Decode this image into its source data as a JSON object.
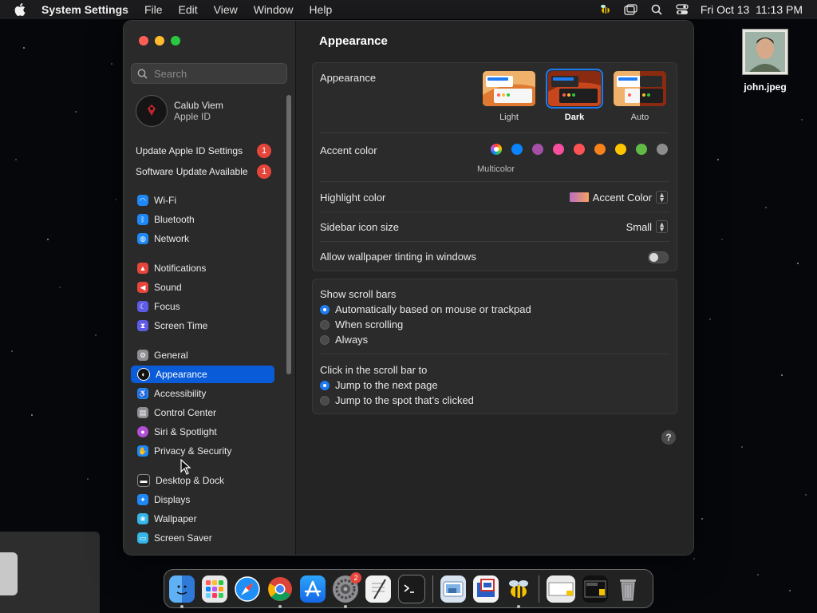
{
  "menubar": {
    "app_name": "System Settings",
    "menus": [
      "File",
      "Edit",
      "View",
      "Window",
      "Help"
    ],
    "clock": "Fri Oct 13  11:13 PM",
    "status_icons": [
      "bee-icon",
      "window-icon",
      "search-icon",
      "control-center-icon"
    ]
  },
  "desktop": {
    "file_name": "john.jpeg"
  },
  "sidebar": {
    "search_placeholder": "Search",
    "account": {
      "name": "Calub Viem",
      "sub": "Apple ID"
    },
    "notices": [
      {
        "label": "Update Apple ID Settings",
        "badge": "1"
      },
      {
        "label": "Software Update Available",
        "badge": "1"
      }
    ],
    "items": [
      {
        "label": "Wi-Fi",
        "icon": "wifi-icon",
        "color": "#1e88f7"
      },
      {
        "label": "Bluetooth",
        "icon": "bluetooth-icon",
        "color": "#1e88f7"
      },
      {
        "label": "Network",
        "icon": "globe-icon",
        "color": "#1e88f7"
      },
      {
        "label": "Notifications",
        "icon": "bell-icon",
        "color": "#e5453b"
      },
      {
        "label": "Sound",
        "icon": "speaker-icon",
        "color": "#e5453b"
      },
      {
        "label": "Focus",
        "icon": "moon-icon",
        "color": "#5e5ce6"
      },
      {
        "label": "Screen Time",
        "icon": "hourglass-icon",
        "color": "#5e5ce6"
      },
      {
        "label": "General",
        "icon": "gear-icon",
        "color": "#8e8e93"
      },
      {
        "label": "Appearance",
        "icon": "appearance-icon",
        "color": "#111111"
      },
      {
        "label": "Accessibility",
        "icon": "accessibility-icon",
        "color": "#1e88f7"
      },
      {
        "label": "Control Center",
        "icon": "control-center-icon",
        "color": "#8e8e93"
      },
      {
        "label": "Siri & Spotlight",
        "icon": "siri-icon",
        "color": "#b34fd6"
      },
      {
        "label": "Privacy & Security",
        "icon": "hand-icon",
        "color": "#1e88f7"
      },
      {
        "label": "Desktop & Dock",
        "icon": "dock-icon",
        "color": "#222222"
      },
      {
        "label": "Displays",
        "icon": "display-icon",
        "color": "#1e88f7"
      },
      {
        "label": "Wallpaper",
        "icon": "wallpaper-icon",
        "color": "#35b6e8"
      },
      {
        "label": "Screen Saver",
        "icon": "screensaver-icon",
        "color": "#35b6e8"
      }
    ],
    "selected": "Appearance"
  },
  "content": {
    "title": "Appearance",
    "appearance": {
      "label": "Appearance",
      "options": [
        "Light",
        "Dark",
        "Auto"
      ],
      "selected": "Dark"
    },
    "accent": {
      "label": "Accent color",
      "colors": [
        "multicolor",
        "#0a84ff",
        "#a550a7",
        "#f74f9e",
        "#ff5257",
        "#f7821b",
        "#ffc600",
        "#62ba46",
        "#8c8c8c"
      ],
      "selected_caption": "Multicolor"
    },
    "highlight": {
      "label": "Highlight color",
      "value": "Accent Color"
    },
    "sidebar_icon_size": {
      "label": "Sidebar icon size",
      "value": "Small"
    },
    "wallpaper_tinting": {
      "label": "Allow wallpaper tinting in windows",
      "on": false
    },
    "scroll_bars": {
      "label": "Show scroll bars",
      "options": [
        "Automatically based on mouse or trackpad",
        "When scrolling",
        "Always"
      ],
      "selected": 0
    },
    "click_scroll": {
      "label": "Click in the scroll bar to",
      "options": [
        "Jump to the next page",
        "Jump to the spot that’s clicked"
      ],
      "selected": 0
    },
    "help": "?"
  },
  "dock": {
    "apps": [
      "finder-icon",
      "launchpad-icon",
      "safari-icon",
      "chrome-icon",
      "app-store-icon",
      "system-settings-icon",
      "textedit-icon",
      "terminal-icon",
      "preview-icon",
      "remote-desktop-icon",
      "bee-app-icon",
      "screenshot-icon",
      "screenshot-2-icon",
      "trash-icon"
    ],
    "settings_badge": "2"
  }
}
